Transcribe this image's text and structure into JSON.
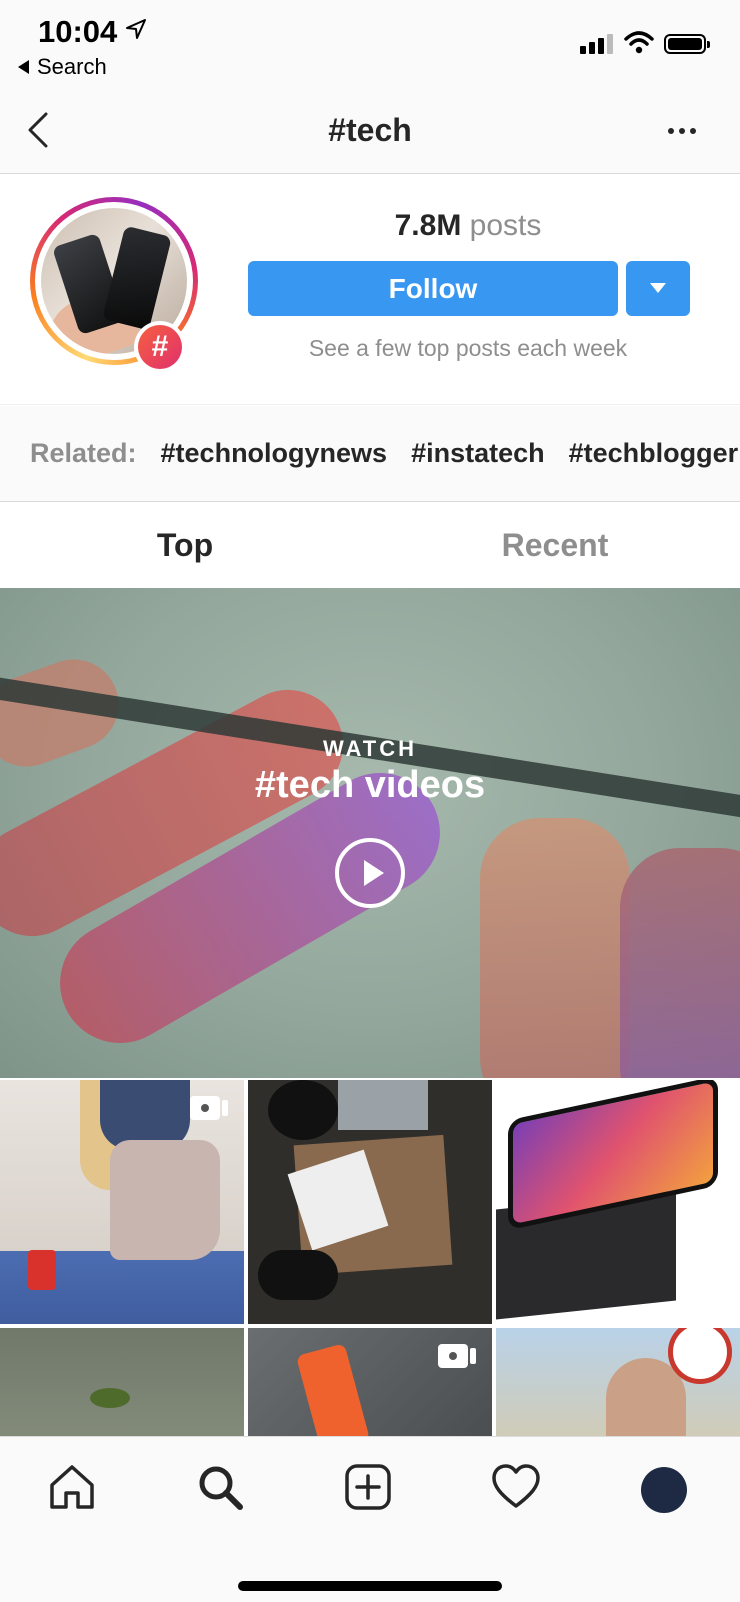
{
  "status_bar": {
    "time": "10:04",
    "back_app": "Search"
  },
  "nav": {
    "title": "#tech"
  },
  "header": {
    "post_count": "7.8M",
    "post_label": "posts",
    "follow_label": "Follow",
    "subtext": "See a few top posts each week",
    "badge_symbol": "#"
  },
  "related": {
    "label": "Related:",
    "tags": [
      "#technologynews",
      "#instatech",
      "#techblogger"
    ]
  },
  "tabs": [
    {
      "label": "Top"
    },
    {
      "label": "Recent"
    }
  ],
  "hero": {
    "kicker": "WATCH",
    "title": "#tech videos"
  },
  "colors": {
    "accent": "#3897f0",
    "muted": "#8e8e8e",
    "text": "#262626"
  }
}
